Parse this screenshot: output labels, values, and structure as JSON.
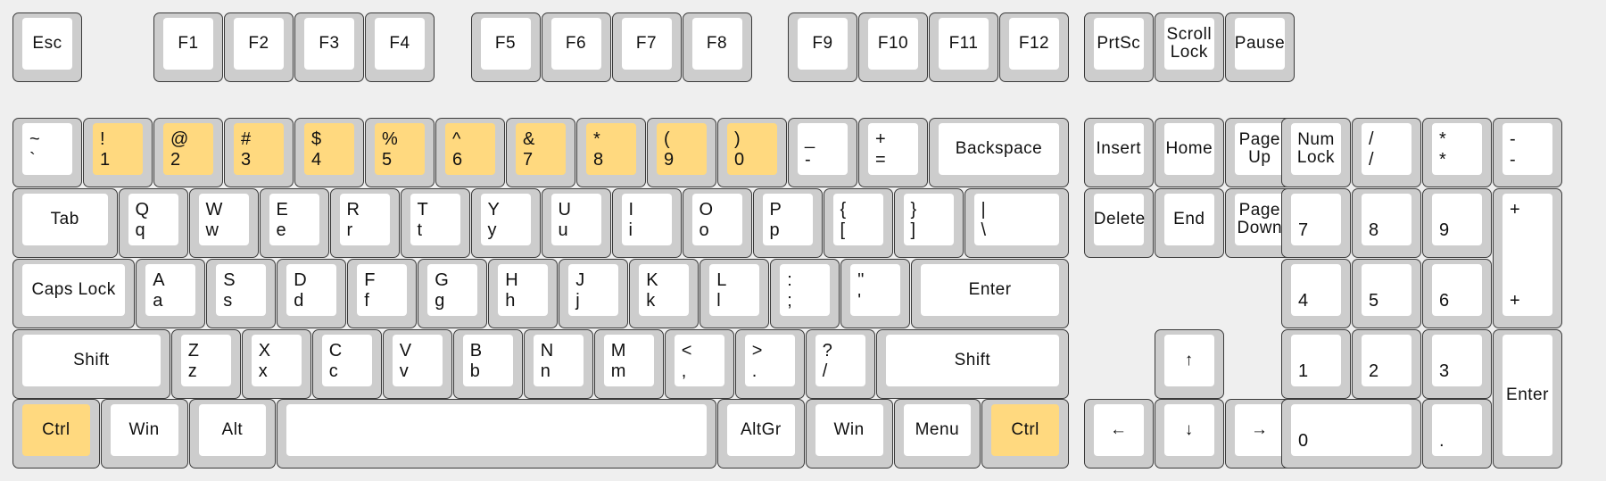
{
  "colors": {
    "background": "#efefef",
    "key_border": "#3a3a3a",
    "key_side": "#cdcdcd",
    "key_cap": "#ffffff",
    "highlight": "#ffd97f"
  },
  "highlighted_keys": [
    "1",
    "2",
    "3",
    "4",
    "5",
    "6",
    "7",
    "8",
    "9",
    "0",
    "Ctrl-left",
    "Ctrl-right"
  ],
  "rows": {
    "function": [
      {
        "id": "esc",
        "c": "Esc"
      },
      {
        "id": "f1",
        "c": "F1"
      },
      {
        "id": "f2",
        "c": "F2"
      },
      {
        "id": "f3",
        "c": "F3"
      },
      {
        "id": "f4",
        "c": "F4"
      },
      {
        "id": "f5",
        "c": "F5"
      },
      {
        "id": "f6",
        "c": "F6"
      },
      {
        "id": "f7",
        "c": "F7"
      },
      {
        "id": "f8",
        "c": "F8"
      },
      {
        "id": "f9",
        "c": "F9"
      },
      {
        "id": "f10",
        "c": "F10"
      },
      {
        "id": "f11",
        "c": "F11"
      },
      {
        "id": "f12",
        "c": "F12"
      },
      {
        "id": "prtsc",
        "c": "PrtSc"
      },
      {
        "id": "scroll-lock",
        "c": "Scroll\nLock"
      },
      {
        "id": "pause",
        "c": "Pause"
      }
    ],
    "number": [
      {
        "id": "grave",
        "t": "~",
        "b": "`"
      },
      {
        "id": "1",
        "t": "!",
        "b": "1",
        "hl": true
      },
      {
        "id": "2",
        "t": "@",
        "b": "2",
        "hl": true
      },
      {
        "id": "3",
        "t": "#",
        "b": "3",
        "hl": true
      },
      {
        "id": "4",
        "t": "$",
        "b": "4",
        "hl": true
      },
      {
        "id": "5",
        "t": "%",
        "b": "5",
        "hl": true
      },
      {
        "id": "6",
        "t": "^",
        "b": "6",
        "hl": true
      },
      {
        "id": "7",
        "t": "&",
        "b": "7",
        "hl": true
      },
      {
        "id": "8",
        "t": "*",
        "b": "8",
        "hl": true
      },
      {
        "id": "9",
        "t": "(",
        "b": "9",
        "hl": true
      },
      {
        "id": "0",
        "t": ")",
        "b": "0",
        "hl": true
      },
      {
        "id": "minus",
        "t": "_",
        "b": "-"
      },
      {
        "id": "equals",
        "t": "+",
        "b": "="
      },
      {
        "id": "backspace",
        "c": "Backspace"
      }
    ],
    "qwerty": [
      {
        "id": "tab",
        "c": "Tab"
      },
      {
        "id": "q",
        "t": "Q",
        "b": "q"
      },
      {
        "id": "w",
        "t": "W",
        "b": "w"
      },
      {
        "id": "e",
        "t": "E",
        "b": "e"
      },
      {
        "id": "r",
        "t": "R",
        "b": "r"
      },
      {
        "id": "t",
        "t": "T",
        "b": "t"
      },
      {
        "id": "y",
        "t": "Y",
        "b": "y"
      },
      {
        "id": "u",
        "t": "U",
        "b": "u"
      },
      {
        "id": "i",
        "t": "I",
        "b": "i"
      },
      {
        "id": "o",
        "t": "O",
        "b": "o"
      },
      {
        "id": "p",
        "t": "P",
        "b": "p"
      },
      {
        "id": "lbracket",
        "t": "{",
        "b": "["
      },
      {
        "id": "rbracket",
        "t": "}",
        "b": "]"
      },
      {
        "id": "backslash",
        "t": "|",
        "b": "\\"
      }
    ],
    "home": [
      {
        "id": "caps-lock",
        "c": "Caps Lock"
      },
      {
        "id": "a",
        "t": "A",
        "b": "a"
      },
      {
        "id": "s",
        "t": "S",
        "b": "s"
      },
      {
        "id": "d",
        "t": "D",
        "b": "d"
      },
      {
        "id": "f",
        "t": "F",
        "b": "f"
      },
      {
        "id": "g",
        "t": "G",
        "b": "g"
      },
      {
        "id": "h",
        "t": "H",
        "b": "h"
      },
      {
        "id": "j",
        "t": "J",
        "b": "j"
      },
      {
        "id": "k",
        "t": "K",
        "b": "k"
      },
      {
        "id": "l",
        "t": "L",
        "b": "l"
      },
      {
        "id": "semicolon",
        "t": ":",
        "b": ";"
      },
      {
        "id": "quote",
        "t": "\"",
        "b": "'"
      },
      {
        "id": "enter",
        "c": "Enter"
      }
    ],
    "shift": [
      {
        "id": "shift-left",
        "c": "Shift"
      },
      {
        "id": "z",
        "t": "Z",
        "b": "z"
      },
      {
        "id": "x",
        "t": "X",
        "b": "x"
      },
      {
        "id": "c",
        "t": "C",
        "b": "c"
      },
      {
        "id": "v",
        "t": "V",
        "b": "v"
      },
      {
        "id": "b",
        "t": "B",
        "b": "b"
      },
      {
        "id": "n",
        "t": "N",
        "b": "n"
      },
      {
        "id": "m",
        "t": "M",
        "b": "m"
      },
      {
        "id": "comma",
        "t": "<",
        "b": ","
      },
      {
        "id": "period",
        "t": ">",
        "b": "."
      },
      {
        "id": "slash",
        "t": "?",
        "b": "/"
      },
      {
        "id": "shift-right",
        "c": "Shift"
      }
    ],
    "bottom": [
      {
        "id": "ctrl-left",
        "c": "Ctrl",
        "hl": true
      },
      {
        "id": "win-left",
        "c": "Win"
      },
      {
        "id": "alt",
        "c": "Alt"
      },
      {
        "id": "space",
        "c": ""
      },
      {
        "id": "altgr",
        "c": "AltGr"
      },
      {
        "id": "win-right",
        "c": "Win"
      },
      {
        "id": "menu",
        "c": "Menu"
      },
      {
        "id": "ctrl-right",
        "c": "Ctrl",
        "hl": true
      }
    ],
    "navigation": [
      {
        "id": "insert",
        "c": "Insert"
      },
      {
        "id": "home",
        "c": "Home"
      },
      {
        "id": "page-up",
        "c": "Page\nUp"
      },
      {
        "id": "delete",
        "c": "Delete"
      },
      {
        "id": "end",
        "c": "End"
      },
      {
        "id": "page-down",
        "c": "Page\nDown"
      },
      {
        "id": "arrow-up",
        "c": "↑"
      },
      {
        "id": "arrow-left",
        "c": "←"
      },
      {
        "id": "arrow-down",
        "c": "↓"
      },
      {
        "id": "arrow-right",
        "c": "→"
      }
    ],
    "numpad": [
      {
        "id": "num-lock",
        "c": "Num\nLock"
      },
      {
        "id": "np-divide",
        "t": "/",
        "b": "/"
      },
      {
        "id": "np-multiply",
        "t": "*",
        "b": "*"
      },
      {
        "id": "np-minus",
        "t": "-",
        "b": "-"
      },
      {
        "id": "np-7",
        "b": "7"
      },
      {
        "id": "np-8",
        "b": "8"
      },
      {
        "id": "np-9",
        "b": "9"
      },
      {
        "id": "np-plus",
        "t": "+",
        "b": "+"
      },
      {
        "id": "np-4",
        "b": "4"
      },
      {
        "id": "np-5",
        "b": "5"
      },
      {
        "id": "np-6",
        "b": "6"
      },
      {
        "id": "np-1",
        "b": "1"
      },
      {
        "id": "np-2",
        "b": "2"
      },
      {
        "id": "np-3",
        "b": "3"
      },
      {
        "id": "np-enter",
        "c": "Enter"
      },
      {
        "id": "np-0",
        "b": "0"
      },
      {
        "id": "np-decimal",
        "b": "."
      }
    ]
  }
}
